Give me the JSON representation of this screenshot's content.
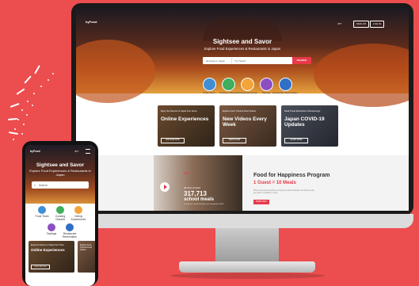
{
  "colors": {
    "background": "#ec4d4f",
    "accent": "#e8394a",
    "cat_tours": "#3f8fd6",
    "cat_cooking": "#3fae5d",
    "cat_dining": "#f2a53a",
    "cat_tastings": "#8c4fc1",
    "cat_restaurant": "#2f6fc7"
  },
  "desktop": {
    "logo": "byFood",
    "lang": "JPY",
    "signup": "SIGN UP",
    "login": "LOG IN",
    "title": "Sightsee and Savor",
    "subtitle": "Explore Food Experiences & Restaurants in Japan",
    "search_area": "All Areas in Japan",
    "search_placeholder": "Try \"Sushi\"",
    "search_button": "SEARCH",
    "categories": [
      {
        "label": "Food Tours",
        "icon": "food-tours-icon"
      },
      {
        "label": "Cooking Classes",
        "icon": "cooking-classes-icon"
      },
      {
        "label": "Dining Experiences",
        "icon": "dining-experiences-icon"
      },
      {
        "label": "Tastings",
        "icon": "tastings-icon"
      },
      {
        "label": "Restaurant Reservation",
        "icon": "restaurant-reservation-icon"
      }
    ],
    "cards": [
      {
        "kicker": "Enjoy the Flavours of Japan from Home",
        "title": "Online Experiences",
        "button": "EXPLORE NOW"
      },
      {
        "kicker": "Explore Food, Travel & Food Culture",
        "title": "New Videos Every Week",
        "button": "WATCH NOW"
      },
      {
        "kicker": "Read Travel Restrictions & Reopenings",
        "title": "Japan COVID-19 Updates",
        "button": "LEARN MORE"
      }
    ],
    "promo": {
      "logo_text": "FIP",
      "stat_label": "We have provided",
      "stat_number": "317,713",
      "stat_unit": "school meals",
      "stat_note": "to children in Southeast Asia since September 2020",
      "title": "Food for Happiness Program",
      "subtitle": "1 Guest = 10 Meals",
      "body": "When you book something on byFood, byFood donates 10 school meals per guest to children in need.",
      "button": "MORE INFO"
    }
  },
  "phone": {
    "logo": "byFood",
    "lang": "JPY",
    "title": "Sightsee and Savor",
    "subtitle": "Explore Food Experiences & Restaurants in Japan",
    "search_placeholder": "Search",
    "categories": [
      "Food Tours",
      "Cooking Classes",
      "Dining Experiences",
      "Tastings",
      "Restaurant Reservation"
    ],
    "card1": {
      "kicker": "Enjoy the Flavours of Japan from Home",
      "title": "Online Experiences",
      "button": "EXPLORE NOW"
    },
    "card2_kicker": "Explore Food, Travel & Food Culture"
  }
}
